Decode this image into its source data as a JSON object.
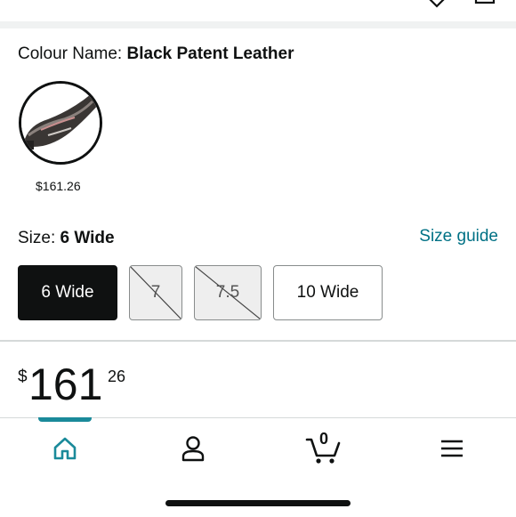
{
  "colour": {
    "label": "Colour Name:",
    "value": "Black Patent Leather",
    "swatches": [
      {
        "price": "$161.26",
        "selected": true
      }
    ]
  },
  "size": {
    "label": "Size:",
    "value": "6 Wide",
    "guide_label": "Size guide",
    "options": [
      {
        "label": "6 Wide",
        "state": "selected"
      },
      {
        "label": "7",
        "state": "unavailable"
      },
      {
        "label": "7.5",
        "state": "unavailable"
      },
      {
        "label": "10 Wide",
        "state": "available"
      }
    ]
  },
  "price": {
    "currency": "$",
    "whole": "161",
    "fraction": "26"
  },
  "bottom_nav": {
    "items": [
      {
        "icon": "home-icon",
        "active": true
      },
      {
        "icon": "account-icon",
        "active": false
      },
      {
        "icon": "cart-icon",
        "active": false,
        "badge": "0"
      },
      {
        "icon": "menu-icon",
        "active": false
      }
    ],
    "active_color": "#1a8a9a"
  },
  "colors": {
    "link": "#007185",
    "selected_bg": "#0f1111",
    "text": "#0f1111"
  }
}
